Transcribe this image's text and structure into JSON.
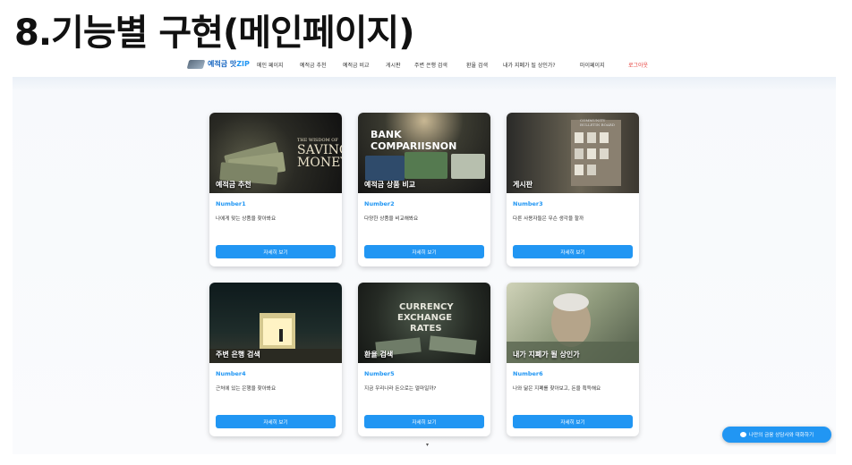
{
  "slide_title": "8.기능별 구현(메인페이지)",
  "brand": {
    "name_main": "예적금 맛",
    "name_accent": "ZIP"
  },
  "nav": {
    "items": [
      "메인 페이지",
      "예적금 추천",
      "예적금 비교",
      "게시판",
      "주변 은행 검색",
      "환율 검색",
      "내가 지폐가 될 상인가?",
      "마이페이지",
      "로그아웃"
    ]
  },
  "cards": [
    {
      "caption": "예적금 추천",
      "number": "Number1",
      "desc": "나에게 맞는 상품을 찾아봐요",
      "button": "자세히 보기",
      "img_text": [
        "THE WISDOM OF",
        "SAVING",
        "MONEY."
      ]
    },
    {
      "caption": "예적금 상품 비교",
      "number": "Number2",
      "desc": "다양한 상품을 비교해봐요",
      "button": "자세히 보기",
      "img_text": [
        "BANK COMPARIISNON"
      ]
    },
    {
      "caption": "게시판",
      "number": "Number3",
      "desc": "다른 사용자들은 무슨 생각을 할까",
      "button": "자세히 보기",
      "img_text": [
        "COMMUNITY",
        "BULLETIN BOARD"
      ]
    },
    {
      "caption": "주변 은행 검색",
      "number": "Number4",
      "desc": "근처에 있는 은행을 찾아봐요",
      "button": "자세히 보기",
      "img_text": []
    },
    {
      "caption": "환율 검색",
      "number": "Number5",
      "desc": "지금 우리나라 돈으로는 얼마일까?",
      "button": "자세히 보기",
      "img_text": [
        "CURRENCY",
        "EXCHANGE",
        "RATES"
      ]
    },
    {
      "caption": "내가 지폐가 될 상인가",
      "number": "Number6",
      "desc": "나와 닮은 지폐를 찾아보고, 돈을 획득해요",
      "button": "자세히 보기",
      "img_text": []
    }
  ],
  "chat_button": "나만의 금융 상담사와 대화하기",
  "colors": {
    "accent": "#2196f3",
    "logout": "#e53935"
  }
}
